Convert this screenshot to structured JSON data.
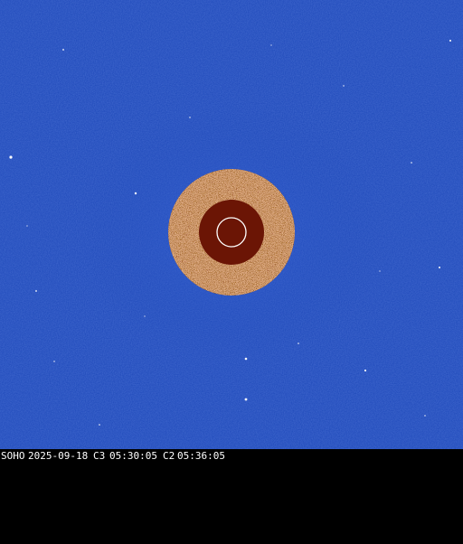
{
  "caption": {
    "observatory": "SOHO",
    "date": "2025-09-18",
    "c3_label": "C3",
    "c3_time": "05:30:05",
    "c2_label": "C2",
    "c2_time": "05:36:05"
  },
  "colors": {
    "sky": "#1c47b8",
    "occulter_disk": "#6b1505",
    "c2_ring_base": "#7a2a10",
    "sun_outline": "#ffffff",
    "caption_text": "#ffffff",
    "caption_background": "#000000"
  }
}
